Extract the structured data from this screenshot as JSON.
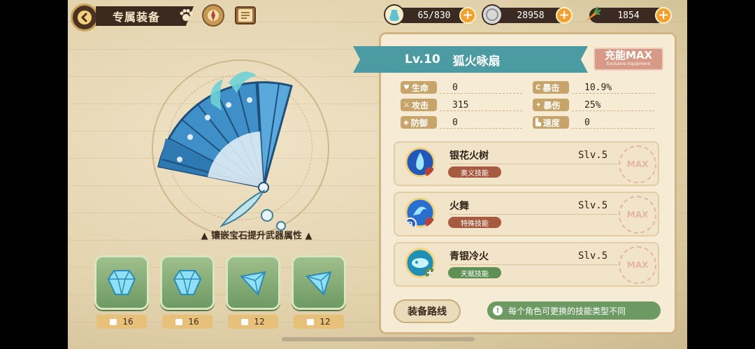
{
  "header": {
    "title": "专属装备",
    "resources": [
      {
        "icon": "stamina-potion-icon",
        "value": "65/830"
      },
      {
        "icon": "silver-coin-icon",
        "value": "28958"
      },
      {
        "icon": "carrot-icon",
        "value": "1854"
      }
    ]
  },
  "weapon": {
    "level": "Lv.10",
    "name": "狐火咏扇",
    "charge_label": "充能MAX",
    "charge_sub": "Exclusive Equipment"
  },
  "stats": [
    {
      "label": "生命",
      "value": "0",
      "icon": "heart-icon"
    },
    {
      "label": "攻击",
      "value": "315",
      "icon": "sword-icon"
    },
    {
      "label": "防御",
      "value": "0",
      "icon": "shield-icon"
    },
    {
      "label": "暴击",
      "value": "10.9%",
      "icon": "crit-icon"
    },
    {
      "label": "暴伤",
      "value": "25%",
      "icon": "crit-damage-icon"
    },
    {
      "label": "速度",
      "value": "0",
      "icon": "boot-icon"
    }
  ],
  "skills": [
    {
      "name": "银花火树",
      "level": "Slv.5",
      "tag": "奥义技能",
      "tag_color": "#a65a3f",
      "max": "MAX"
    },
    {
      "name": "火舞",
      "level": "Slv.5",
      "tag": "特殊技能",
      "tag_color": "#a65a3f",
      "max": "MAX"
    },
    {
      "name": "青银冷火",
      "level": "Slv.5",
      "tag": "天赋技能",
      "tag_color": "#5e8f55",
      "max": "MAX"
    }
  ],
  "gems": {
    "caption": "镶嵌宝石提升武器属性",
    "slots": [
      {
        "count": "16"
      },
      {
        "count": "16"
      },
      {
        "count": "12"
      },
      {
        "count": "12"
      }
    ]
  },
  "footer": {
    "route_button": "装备路线",
    "tip": "每个角色可更换的技能类型不同"
  }
}
